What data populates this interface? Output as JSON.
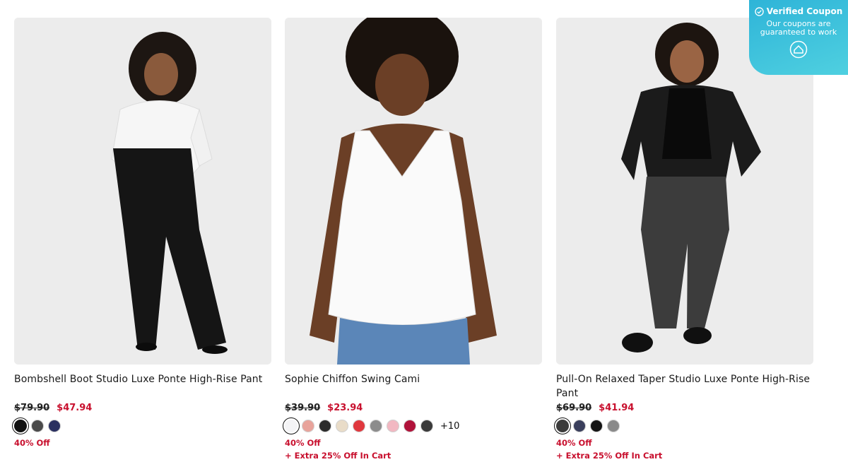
{
  "coupon": {
    "title": "Verified Coupon",
    "subtitle": "Our coupons are guaranteed to work"
  },
  "products": [
    {
      "name": "Bombshell Boot Studio Luxe Ponte High-Rise Pant",
      "original_price": "$79.90",
      "sale_price": "$47.94",
      "swatches": [
        "#111111",
        "#4a4a4a",
        "#2a3060"
      ],
      "more_colors": "",
      "promos": [
        "40% Off"
      ]
    },
    {
      "name": "Sophie Chiffon Swing Cami",
      "original_price": "$39.90",
      "sale_price": "$23.94",
      "swatches": [
        "#f4f4f6",
        "#e8a39b",
        "#2b2b2b",
        "#e9dcc8",
        "#e0383e",
        "#8c8c8c",
        "#f2b8c2",
        "#b0123a",
        "#3a3a3a"
      ],
      "more_colors": "+10",
      "promos": [
        "40% Off",
        "+ Extra 25% Off In Cart"
      ]
    },
    {
      "name": "Pull-On Relaxed Taper Studio Luxe Ponte High-Rise Pant",
      "original_price": "$69.90",
      "sale_price": "$41.94",
      "swatches": [
        "#3b3b3b",
        "#3a3f5c",
        "#141414",
        "#8a8a8a"
      ],
      "more_colors": "",
      "promos": [
        "40% Off",
        "+ Extra 25% Off In Cart"
      ]
    }
  ]
}
